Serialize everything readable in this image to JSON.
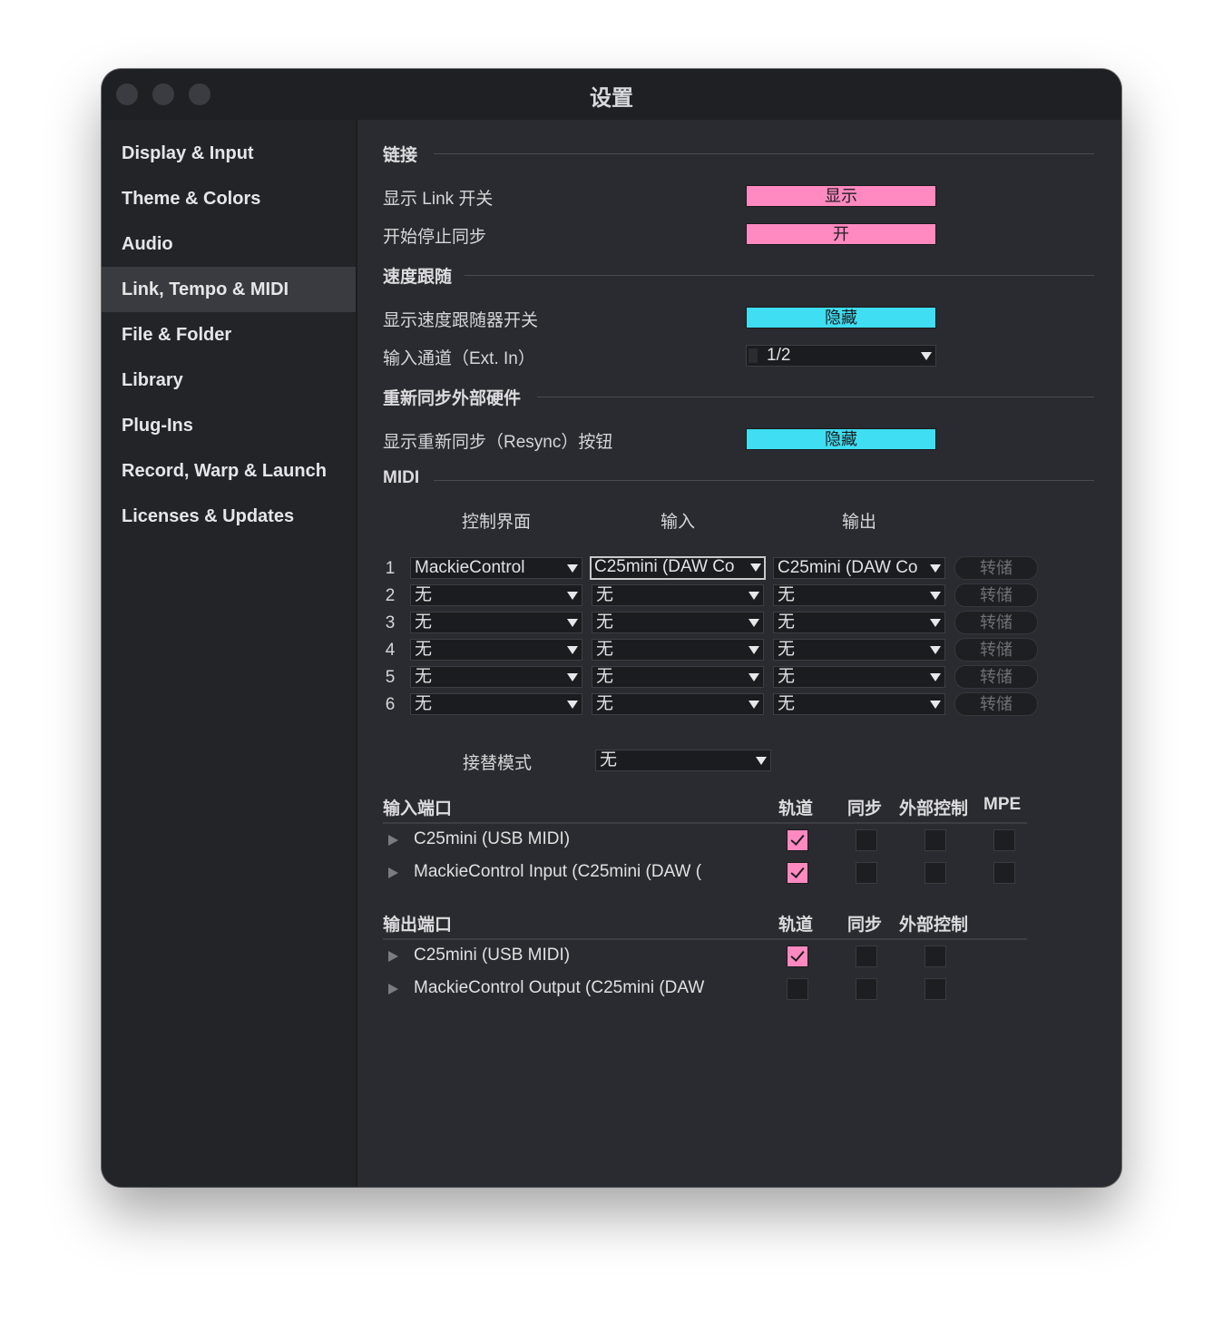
{
  "window": {
    "title": "设置"
  },
  "sidebar": {
    "items": [
      {
        "label": "Display & Input",
        "active": false
      },
      {
        "label": "Theme & Colors",
        "active": false
      },
      {
        "label": "Audio",
        "active": false
      },
      {
        "label": "Link, Tempo & MIDI",
        "active": true
      },
      {
        "label": "File & Folder",
        "active": false
      },
      {
        "label": "Library",
        "active": false
      },
      {
        "label": "Plug-Ins",
        "active": false
      },
      {
        "label": "Record, Warp & Launch",
        "active": false
      },
      {
        "label": "Licenses & Updates",
        "active": false
      }
    ]
  },
  "link": {
    "title": "链接",
    "show_link_label": "显示 Link 开关",
    "show_link_value": "显示",
    "start_stop_label": "开始停止同步",
    "start_stop_value": "开"
  },
  "tempo_follower": {
    "title": "速度跟随",
    "show_label": "显示速度跟随器开关",
    "show_value": "隐藏",
    "input_channel_label": "输入通道（Ext. In）",
    "input_channel_value": "1/2"
  },
  "resync": {
    "title": "重新同步外部硬件",
    "show_label": "显示重新同步（Resync）按钮",
    "show_value": "隐藏"
  },
  "midi": {
    "title": "MIDI",
    "col_control_surface": "控制界面",
    "col_input": "输入",
    "col_output": "输出",
    "dump_label": "转储",
    "rows": [
      {
        "num": "1",
        "surface": "MackieControl",
        "input": "C25mini (DAW Co",
        "output": "C25mini (DAW Co"
      },
      {
        "num": "2",
        "surface": "无",
        "input": "无",
        "output": "无"
      },
      {
        "num": "3",
        "surface": "无",
        "input": "无",
        "output": "无"
      },
      {
        "num": "4",
        "surface": "无",
        "input": "无",
        "output": "无"
      },
      {
        "num": "5",
        "surface": "无",
        "input": "无",
        "output": "无"
      },
      {
        "num": "6",
        "surface": "无",
        "input": "无",
        "output": "无"
      }
    ],
    "takeover_label": "接替模式",
    "takeover_value": "无"
  },
  "input_ports": {
    "title": "输入端口",
    "col_track": "轨道",
    "col_sync": "同步",
    "col_remote": "外部控制",
    "col_mpe": "MPE",
    "ports": [
      {
        "name": "C25mini (USB MIDI)",
        "track": true,
        "sync": false,
        "remote": false,
        "mpe": false
      },
      {
        "name": "MackieControl Input (C25mini (DAW (",
        "track": true,
        "sync": false,
        "remote": false,
        "mpe": false
      }
    ]
  },
  "output_ports": {
    "title": "输出端口",
    "col_track": "轨道",
    "col_sync": "同步",
    "col_remote": "外部控制",
    "ports": [
      {
        "name": "C25mini (USB MIDI)",
        "track": true,
        "sync": false,
        "remote": false
      },
      {
        "name": "MackieControl Output (C25mini (DAW",
        "track": false,
        "sync": false,
        "remote": false
      }
    ]
  },
  "colors": {
    "toggle_pink": "#ff89c0",
    "toggle_cyan": "#3fdef2",
    "window_bg": "#2a2b30",
    "sidebar_bg": "#232428"
  }
}
